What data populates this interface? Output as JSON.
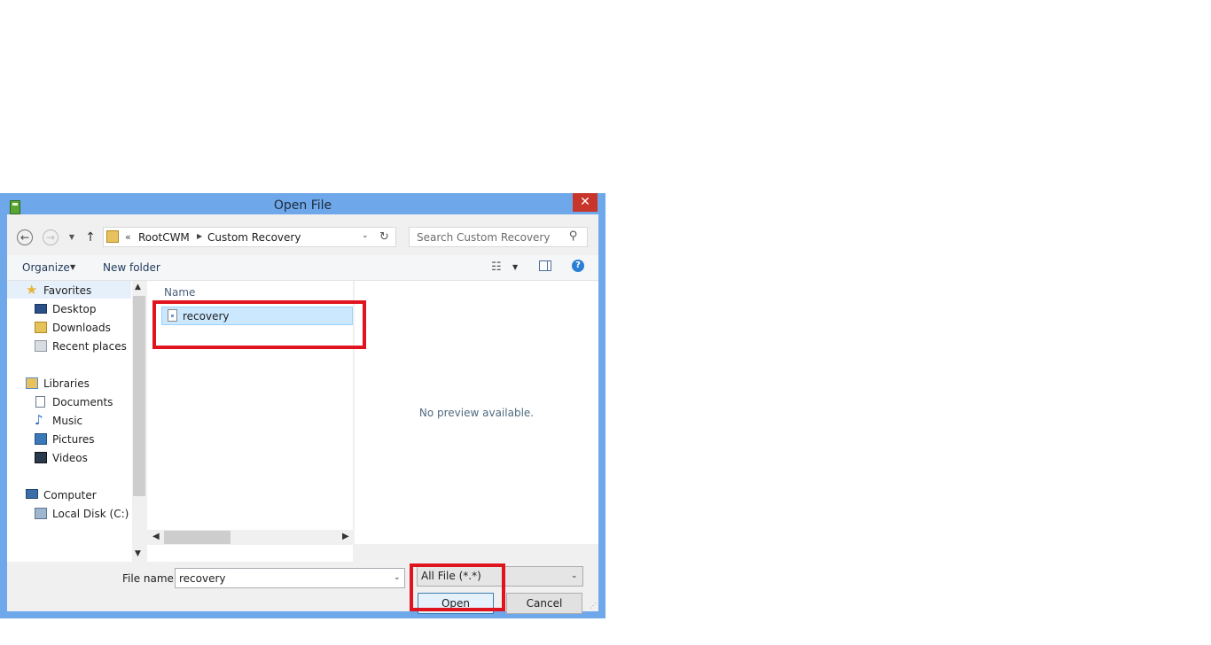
{
  "window": {
    "title": "Open File",
    "close_glyph": "✕"
  },
  "address": {
    "chevrons": "«",
    "breadcrumbs": [
      "RootCWM",
      "Custom Recovery"
    ]
  },
  "search": {
    "placeholder": "Search Custom Recovery"
  },
  "toolbar": {
    "organize_label": "Organize",
    "new_folder_label": "New folder"
  },
  "nav": {
    "items": [
      {
        "label": "Favorites",
        "icon": "star-icon",
        "group": true
      },
      {
        "label": "Desktop",
        "icon": "desktop-icon"
      },
      {
        "label": "Downloads",
        "icon": "downloads-icon"
      },
      {
        "label": "Recent places",
        "icon": "recent-places-icon"
      },
      {
        "label": "Libraries",
        "icon": "libraries-icon",
        "group": true
      },
      {
        "label": "Documents",
        "icon": "documents-icon"
      },
      {
        "label": "Music",
        "icon": "music-icon"
      },
      {
        "label": "Pictures",
        "icon": "pictures-icon"
      },
      {
        "label": "Videos",
        "icon": "videos-icon"
      },
      {
        "label": "Computer",
        "icon": "computer-icon",
        "group": true
      },
      {
        "label": "Local Disk (C:)",
        "icon": "local-disk-icon"
      }
    ]
  },
  "file_list": {
    "column_name": "Name",
    "files": [
      {
        "name": "recovery",
        "selected": true
      }
    ]
  },
  "preview": {
    "message": "No preview available."
  },
  "bottom": {
    "file_name_label": "File name:",
    "file_name_value": "recovery",
    "file_type_value": "All File (*.*)",
    "open_label": "Open",
    "cancel_label": "Cancel"
  },
  "colors": {
    "frame": "#6fa8ea",
    "close": "#c7352b",
    "selection": "#cce8ff",
    "highlight": "#e0141e"
  }
}
